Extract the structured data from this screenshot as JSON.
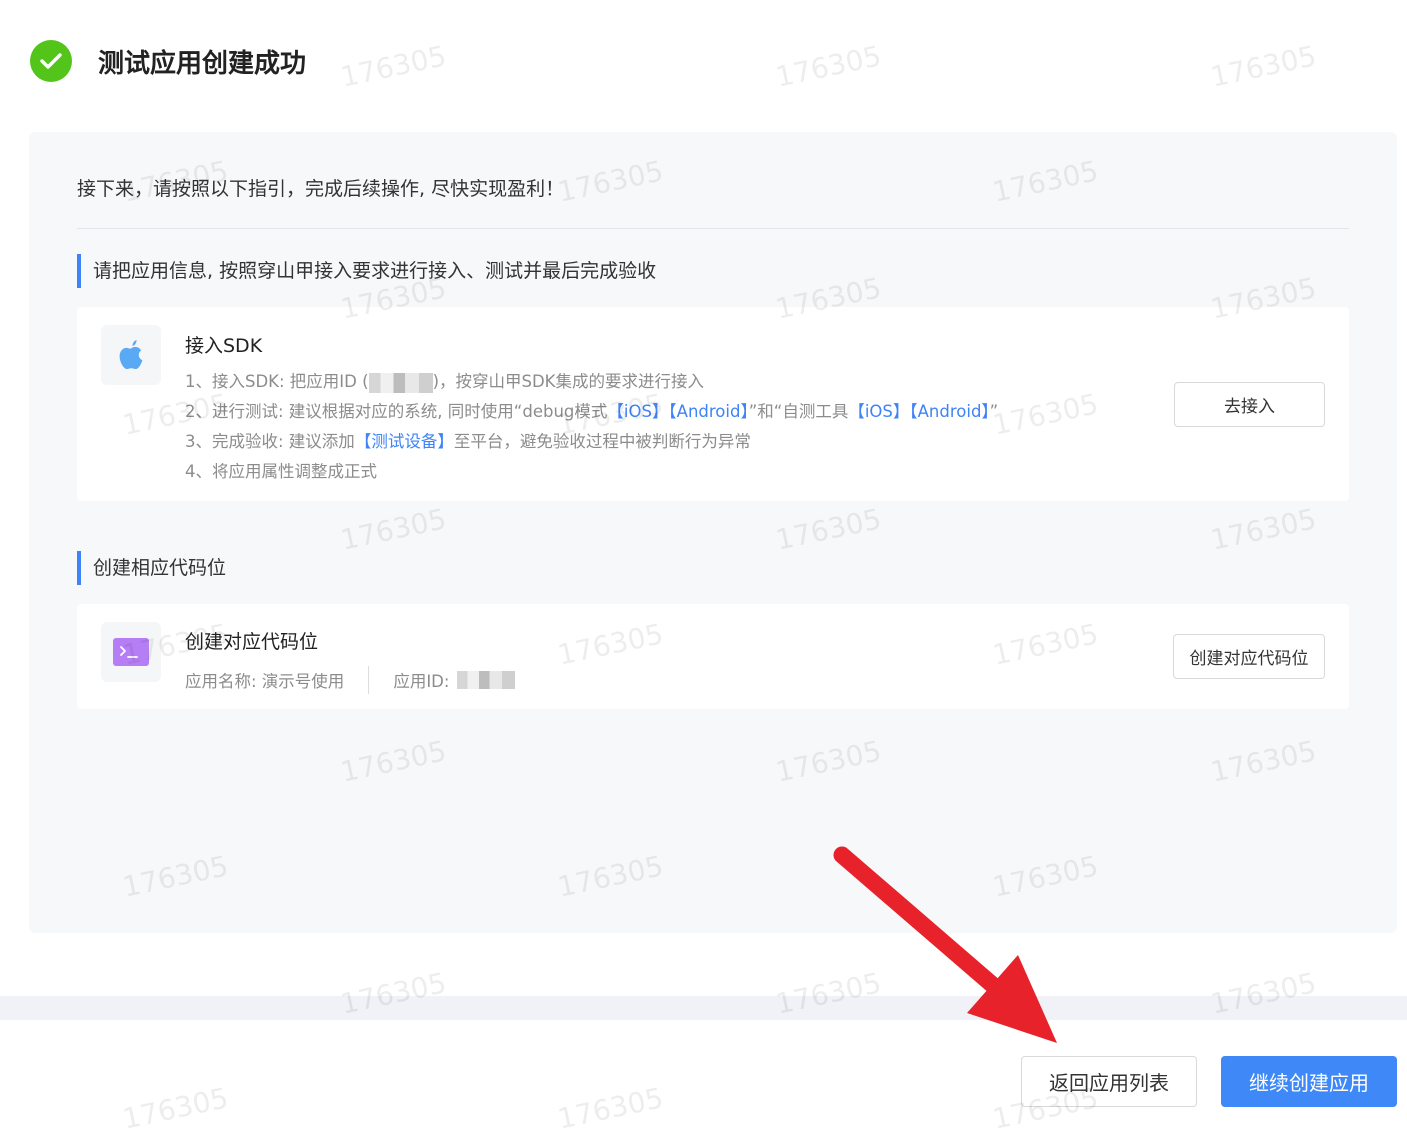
{
  "header": {
    "title": "测试应用创建成功"
  },
  "intro": "接下来，请按照以下指引，完成后续操作, 尽快实现盈利！",
  "section1": {
    "heading": "请把应用信息, 按照穿山甲接入要求进行接入、测试并最后完成验收",
    "card": {
      "title": "接入SDK",
      "step1_a": "1、接入SDK: 把应用ID (",
      "step1_b": ")，按穿山甲SDK集成的要求进行接入",
      "step2_a": "2、进行测试: 建议根据对应的系统, 同时使用“debug模式",
      "step2_ios": "【iOS】",
      "step2_android": "【Android】",
      "step2_mid": "”和“自测工具",
      "step2_ios2": "【iOS】",
      "step2_android2": "【Android】",
      "step2_end": "”",
      "step3_a": "3、完成验收: 建议添加",
      "step3_link": "【测试设备】",
      "step3_b": "至平台，避免验收过程中被判断行为异常",
      "step4": "4、将应用属性调整成正式",
      "button": "去接入"
    }
  },
  "section2": {
    "heading": "创建相应代码位",
    "card": {
      "title": "创建对应代码位",
      "app_name": "应用名称: 演示号使用",
      "app_id_label": "应用ID:",
      "button": "创建对应代码位"
    }
  },
  "footer": {
    "back_button": "返回应用列表",
    "continue_button": "继续创建应用"
  },
  "watermark": "176305",
  "icons": {
    "success": "check-circle-icon",
    "sdk": "apple-icon",
    "slot": "terminal-icon",
    "annotation": "red-arrow-icon"
  },
  "colors": {
    "success": "#52c41a",
    "accent": "#3e83f8",
    "primary_button": "#3e88f8",
    "terminal_icon": "#b57ef5",
    "apple_icon": "#5aa9f5",
    "arrow": "#e8222a"
  }
}
